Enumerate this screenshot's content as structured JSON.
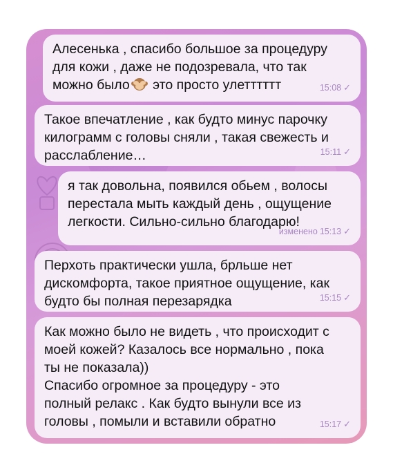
{
  "messages": [
    {
      "text": "Алесенька , спасибо большое за процедуру\nдля кожи , даже не подозревала, что так\nможно было",
      "text_after_emoji": " это просто улетттттт",
      "emoji": "see-no-evil-monkey",
      "time": "15:08",
      "check": "✓"
    },
    {
      "text": "Такое впечатление , как будто минус парочку\nкилограмм с головы сняли , такая свежесть и\nрасслабление…",
      "time": "15:11",
      "check": "✓"
    },
    {
      "text": "я так довольна, появился обьем , волосы\nперестала мыть каждый день , ощущение\nлегкости. Сильно-сильно благодарю!",
      "edited": "изменено",
      "time": "15:13",
      "check": "✓"
    },
    {
      "text": "Перхоть практически ушла, брльше нет\nдискомфорта, такое приятное ощущение, как\nбудто бы полная перезарядка",
      "time": "15:15",
      "check": "✓"
    },
    {
      "text": "Как можно было не видеть , что происходит с\nмоей кожей? Казалось все нормально , пока\nты не показала))\nСпасибо огромное за процедуру - это\nполный релакс . Как будто вынули все из\nголовы , помыли и вставили обратно",
      "time": "15:17",
      "check": "✓"
    }
  ],
  "colors": {
    "bubble": "#f7eef8",
    "meta": "#a886c0",
    "background_start": "#d68fd0",
    "background_end": "#e79ab9"
  }
}
